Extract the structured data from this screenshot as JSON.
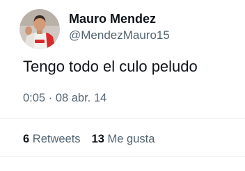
{
  "tweet": {
    "display_name": "Mauro Mendez",
    "handle": "@MendezMauro15",
    "text": "Tengo todo el culo peludo",
    "time": "0:05",
    "separator": "·",
    "date": "08 abr. 14",
    "avatar_icon": "profile-avatar"
  },
  "stats": {
    "retweets_count": "6",
    "retweets_label": "Retweets",
    "likes_count": "13",
    "likes_label": "Me gusta"
  }
}
